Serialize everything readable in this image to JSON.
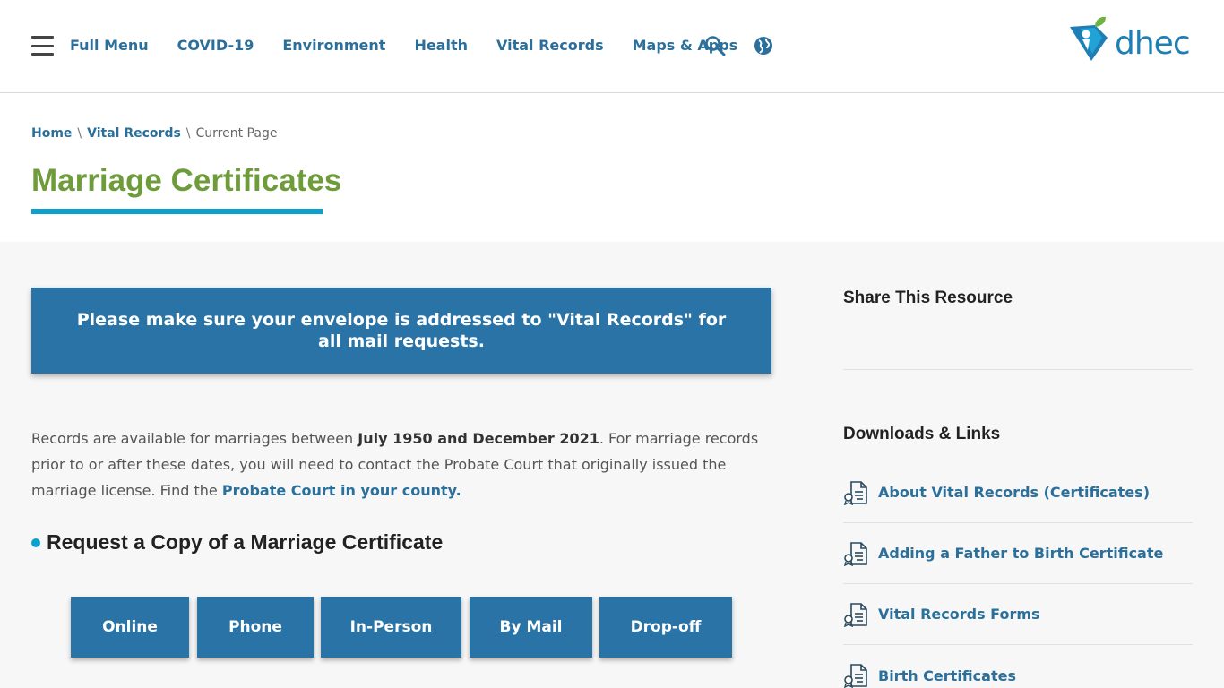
{
  "header": {
    "menu_label": "Full Menu",
    "nav": [
      "COVID-19",
      "Environment",
      "Health",
      "Vital Records",
      "Maps & Apps"
    ],
    "logo_text": "dhec",
    "colors": {
      "nav_link": "#2b6f9b",
      "logo_blue": "#1e7fb5",
      "logo_green": "#6cb33f"
    }
  },
  "breadcrumb": {
    "home": "Home",
    "section": "Vital Records",
    "current": "Current Page"
  },
  "page": {
    "title": "Marriage Certificates",
    "title_color": "#6e9c3b",
    "accent_color": "#0ba1ce"
  },
  "notice": {
    "text": "Please make sure your envelope is addressed to \"Vital Records\" for all mail requests."
  },
  "intro": {
    "part1": "Records are available for marriages between ",
    "bold": "July 1950 and December 2021",
    "part2": ". For marriage records prior to or after these dates, you will need to contact the Probate Court that originally issued the marriage license. Find the ",
    "link": "Probate Court in your county.",
    "part3": ""
  },
  "request": {
    "heading": "Request a Copy of a Marriage Certificate",
    "methods": [
      "Online",
      "Phone",
      "In-Person",
      "By Mail",
      "Drop-off"
    ],
    "button_color": "#2a73a6"
  },
  "sidebar": {
    "share_heading": "Share This Resource",
    "downloads_heading": "Downloads & Links",
    "links": [
      "About Vital Records (Certificates)",
      "Adding a Father to Birth Certificate",
      "Vital Records Forms",
      "Birth Certificates"
    ],
    "link_icon": "document-icon"
  }
}
